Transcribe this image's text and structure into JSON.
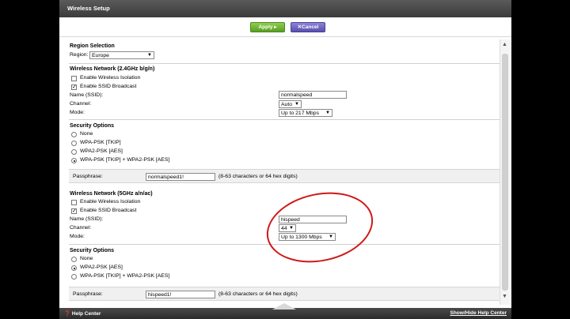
{
  "window": {
    "title": "Wireless Setup"
  },
  "toolbar": {
    "apply": "Apply ▸",
    "cancel": "✕Cancel"
  },
  "region": {
    "heading": "Region Selection",
    "label": "Region:",
    "value": "Europe"
  },
  "band24": {
    "heading": "Wireless Network (2.4GHz b/g/n)",
    "isolation": {
      "label": "Enable Wireless Isolation",
      "checked": false
    },
    "broadcast": {
      "label": "Enable SSID Broadcast",
      "checked": true
    },
    "ssid_label": "Name (SSID):",
    "ssid": "normalspeed",
    "channel_label": "Channel:",
    "channel": "Auto",
    "mode_label": "Mode:",
    "mode": "Up to 217 Mbps"
  },
  "security24": {
    "heading": "Security Options",
    "options": [
      "None",
      "WPA-PSK [TKIP]",
      "WPA2-PSK [AES]",
      "WPA-PSK [TKIP] + WPA2-PSK [AES]"
    ],
    "selected": 3,
    "pass_label": "Passphrase:",
    "passphrase": "normalspeed1!",
    "hint": "(8-63 characters or 64 hex digits)"
  },
  "band5": {
    "heading": "Wireless Network (5GHz a/n/ac)",
    "isolation": {
      "label": "Enable Wireless Isolation",
      "checked": false
    },
    "broadcast": {
      "label": "Enable SSID Broadcast",
      "checked": true
    },
    "ssid_label": "Name (SSID):",
    "ssid": "hispeed",
    "channel_label": "Channel:",
    "channel": "44",
    "mode_label": "Mode:",
    "mode": "Up to 1300 Mbps"
  },
  "security5": {
    "heading": "Security Options",
    "options": [
      "None",
      "WPA2-PSK [AES]",
      "WPA-PSK [TKIP] + WPA2-PSK [AES]"
    ],
    "selected": 1,
    "pass_label": "Passphrase:",
    "passphrase": "hispeed1!",
    "hint": "(8-63 characters or 64 hex digits)"
  },
  "footer": {
    "help": "Help Center",
    "toggle": "Show/Hide Help Center"
  },
  "colors": {
    "apply": "#6db33a",
    "cancel": "#6a5fc1",
    "highlight": "#d01818"
  }
}
